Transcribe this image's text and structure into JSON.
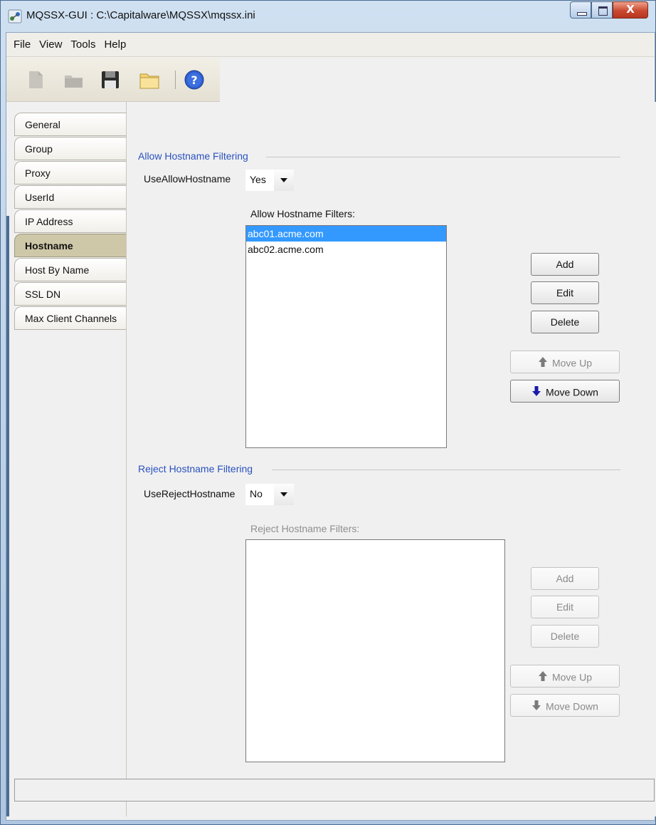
{
  "window": {
    "title": "MQSSX-GUI : C:\\Capitalware\\MQSSX\\mqssx.ini",
    "close_glyph": "X"
  },
  "menubar": {
    "items": [
      "File",
      "View",
      "Tools",
      "Help"
    ]
  },
  "toolbar": {
    "icons": [
      "new-file-icon",
      "open-folder-icon",
      "save-icon",
      "folder-icon",
      "help-icon"
    ]
  },
  "tabs": [
    {
      "label": "General"
    },
    {
      "label": "Group"
    },
    {
      "label": "Proxy"
    },
    {
      "label": "UserId"
    },
    {
      "label": "IP Address"
    },
    {
      "label": "Hostname",
      "active": true
    },
    {
      "label": "Host By Name"
    },
    {
      "label": "SSL DN"
    },
    {
      "label": "Max Client Channels"
    }
  ],
  "allow": {
    "section_title": "Allow Hostname Filtering",
    "field_label": "UseAllowHostname",
    "field_value": "Yes",
    "list_caption": "Allow Hostname Filters:",
    "list_items": [
      "abc01.acme.com",
      "abc02.acme.com"
    ],
    "selected_index": 0,
    "buttons": {
      "add": "Add",
      "edit": "Edit",
      "delete": "Delete",
      "move_up": "Move Up",
      "move_down": "Move Down"
    },
    "enabled": {
      "add": true,
      "edit": true,
      "delete": true,
      "move_up": false,
      "move_down": true
    }
  },
  "reject": {
    "section_title": "Reject Hostname Filtering",
    "field_label": "UseRejectHostname",
    "field_value": "No",
    "list_caption": "Reject Hostname Filters:",
    "list_items": [],
    "buttons": {
      "add": "Add",
      "edit": "Edit",
      "delete": "Delete",
      "move_up": "Move Up",
      "move_down": "Move Down"
    },
    "enabled": {
      "add": false,
      "edit": false,
      "delete": false,
      "move_up": false,
      "move_down": false
    }
  },
  "colors": {
    "section_title": "#2a52be",
    "selection": "#3399ff",
    "active_tab": "#cec7a8",
    "move_down_arrow": "#1a1aa8",
    "move_up_arrow_disabled": "#7a7a7a"
  }
}
